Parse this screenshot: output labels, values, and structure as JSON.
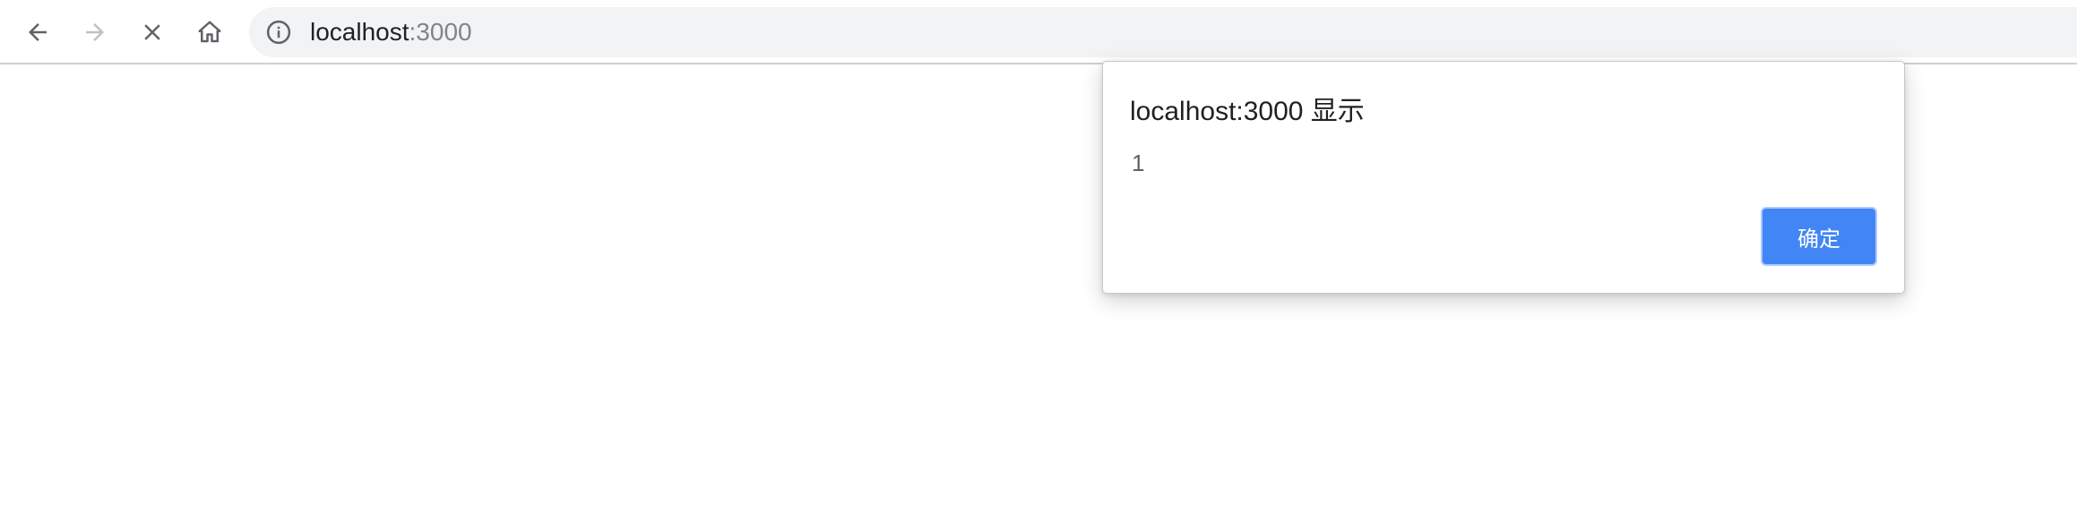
{
  "browser": {
    "nav": {
      "back": {
        "icon": "back-arrow-icon",
        "enabled": true
      },
      "forward": {
        "icon": "forward-arrow-icon",
        "enabled": false
      },
      "stop": {
        "icon": "close-icon"
      },
      "home": {
        "icon": "home-icon"
      }
    },
    "omnibox": {
      "icon": "info-icon",
      "host": "localhost",
      "port": ":3000"
    }
  },
  "dialog": {
    "title": "localhost:3000 显示",
    "message": "1",
    "ok_label": "确定",
    "accent_color": "#4285f4"
  }
}
